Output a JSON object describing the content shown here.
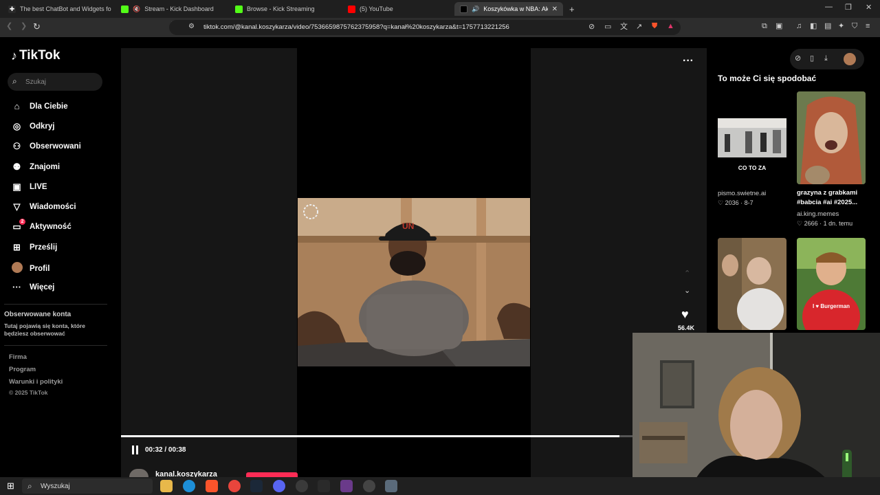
{
  "browser": {
    "tabs": [
      {
        "label": "The best ChatBot and Widgets for Ki",
        "color": "#ffffff"
      },
      {
        "label": "Stream - Kick Dashboard",
        "color": "#53fc18"
      },
      {
        "label": "Browse - Kick Streaming",
        "color": "#53fc18"
      },
      {
        "label": "(5) YouTube",
        "color": "#ff0000"
      },
      {
        "label": "Koszykówka w NBA: Aktualno",
        "color": "#ffffff"
      }
    ],
    "url": "tiktok.com/@kanal.koszykarza/video/7536659875762375958?q=kanał%20koszykarza&t=1757713221256"
  },
  "sidebar": {
    "logo": "TikTok",
    "search_placeholder": "Szukaj",
    "nav": [
      {
        "label": "Dla Ciebie",
        "icon": "home-icon"
      },
      {
        "label": "Odkryj",
        "icon": "compass-icon"
      },
      {
        "label": "Obserwowani",
        "icon": "following-icon"
      },
      {
        "label": "Znajomi",
        "icon": "friends-icon"
      },
      {
        "label": "LIVE",
        "icon": "live-icon"
      },
      {
        "label": "Wiadomości",
        "icon": "messages-icon"
      },
      {
        "label": "Aktywność",
        "icon": "activity-icon",
        "badge": "2"
      },
      {
        "label": "Prześlij",
        "icon": "upload-icon"
      },
      {
        "label": "Profil",
        "icon": "avatar-icon"
      },
      {
        "label": "Więcej",
        "icon": "more-icon"
      }
    ],
    "followed_title": "Obserwowane konta",
    "followed_desc": "Tutaj pojawią się konta, które będziesz obserwować",
    "footer": [
      "Firma",
      "Program",
      "Warunki i polityki"
    ],
    "copyright": "© 2025 TikTok"
  },
  "player": {
    "time": "00:32 / 00:38",
    "progress": 0.975,
    "likes": "56.4K",
    "author": "kanal.koszykarza",
    "cap_text": "UN"
  },
  "recommend": {
    "title": "To może Ci się spodobać",
    "items": [
      {
        "overlay": "CO TO ZA",
        "author": "pismo.swietne.ai",
        "likes": "2036",
        "date": "8-7"
      },
      {
        "title": "grazyna z grabkami #babcia #ai #2025...",
        "author": "ai.king.memes",
        "likes": "2666",
        "date": "1 dn. temu"
      },
      {},
      {
        "shirt": "I ♥ Burgerman"
      }
    ]
  },
  "taskbar": {
    "search": "Wyszukaj"
  }
}
